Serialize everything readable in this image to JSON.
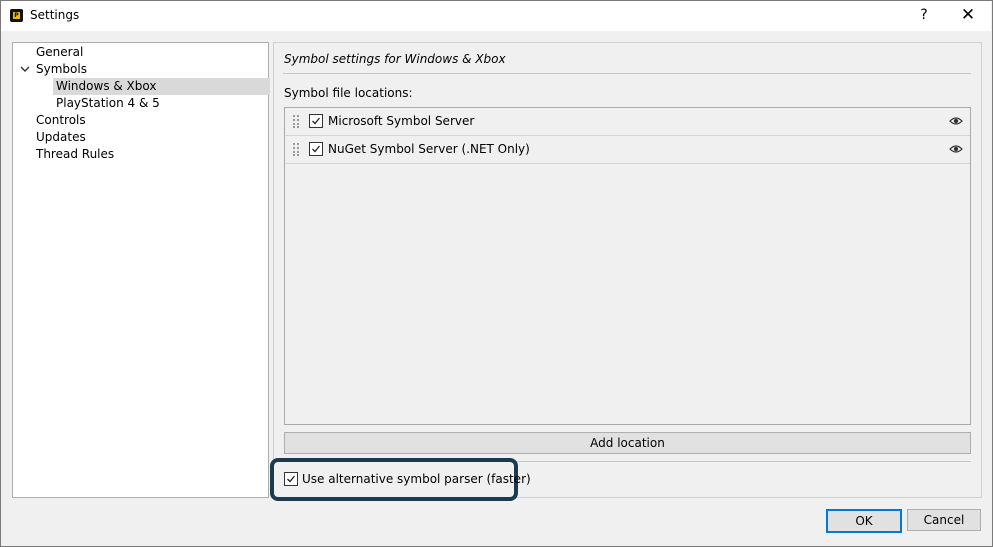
{
  "window": {
    "title": "Settings",
    "help_label": "?",
    "close_label": "✕"
  },
  "tree": {
    "items": [
      {
        "label": "General"
      },
      {
        "label": "Symbols"
      },
      {
        "label": "Windows & Xbox"
      },
      {
        "label": "PlayStation 4 & 5"
      },
      {
        "label": "Controls"
      },
      {
        "label": "Updates"
      },
      {
        "label": "Thread Rules"
      }
    ],
    "selected": "Windows & Xbox"
  },
  "panel": {
    "header": "Symbol settings for Windows & Xbox",
    "locations_label": "Symbol file locations:",
    "locations": [
      {
        "label": "Microsoft Symbol Server",
        "checked": true
      },
      {
        "label": "NuGet Symbol Server (.NET Only)",
        "checked": true
      }
    ],
    "add_location_label": "Add location",
    "alt_parser_label": "Use alternative symbol parser (faster)",
    "alt_parser_checked": true
  },
  "footer": {
    "ok_label": "OK",
    "cancel_label": "Cancel"
  },
  "colors": {
    "focus_border": "#0078d7",
    "highlight_border": "#1b3b4f"
  }
}
